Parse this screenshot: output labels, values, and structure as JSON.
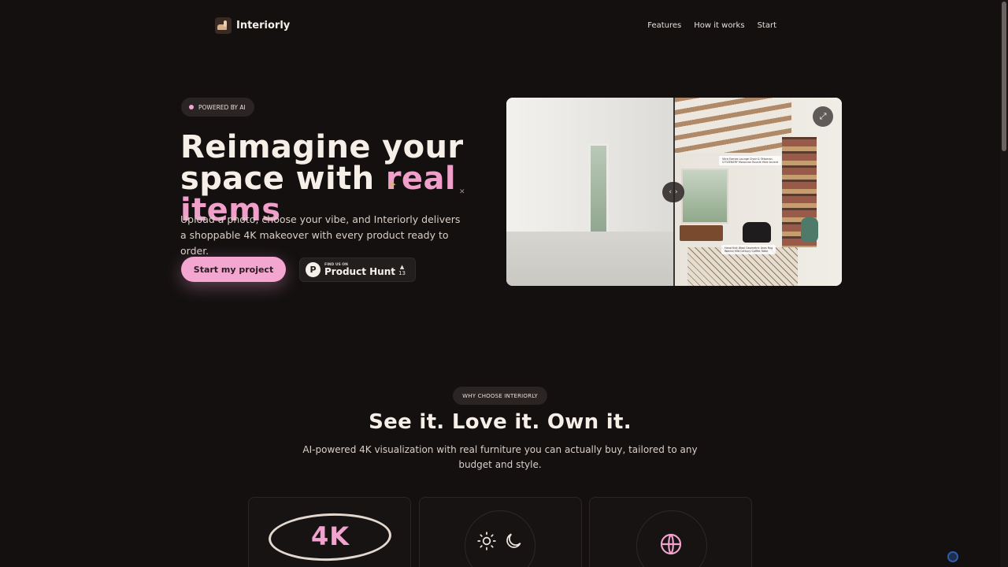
{
  "header": {
    "brand": "Interiorly",
    "nav": [
      "Features",
      "How it works",
      "Start"
    ]
  },
  "hero": {
    "badge": "POWERED BY AI",
    "title_line1": "Reimagine your",
    "title_line2": "space with ",
    "title_accent": "real items",
    "subtitle": "Upload a photo, choose your vibe, and Interiorly delivers a shoppable 4K makeover with every product ready to order.",
    "cta_label": "Start my project",
    "product_hunt": {
      "find_text": "FIND US ON",
      "name": "Product Hunt",
      "votes": "13"
    },
    "image_tags": [
      "Vitra Eames Lounge Chair & Ottoman\nCITIZENERY Moroccan Boucle Hide Accent",
      "Hand Knit Wool Geometric Area Rug\nWalnut Mid Century Coffee Table"
    ]
  },
  "why": {
    "chip": "WHY CHOOSE INTERIORLY",
    "title": "See it. Love it. Own it.",
    "subtitle": "AI-powered 4K visualization with real furniture you can actually buy, tailored to any budget and style.",
    "card1_text": "4K"
  },
  "colors": {
    "background": "#141010",
    "accent": "#f3a6cf"
  }
}
